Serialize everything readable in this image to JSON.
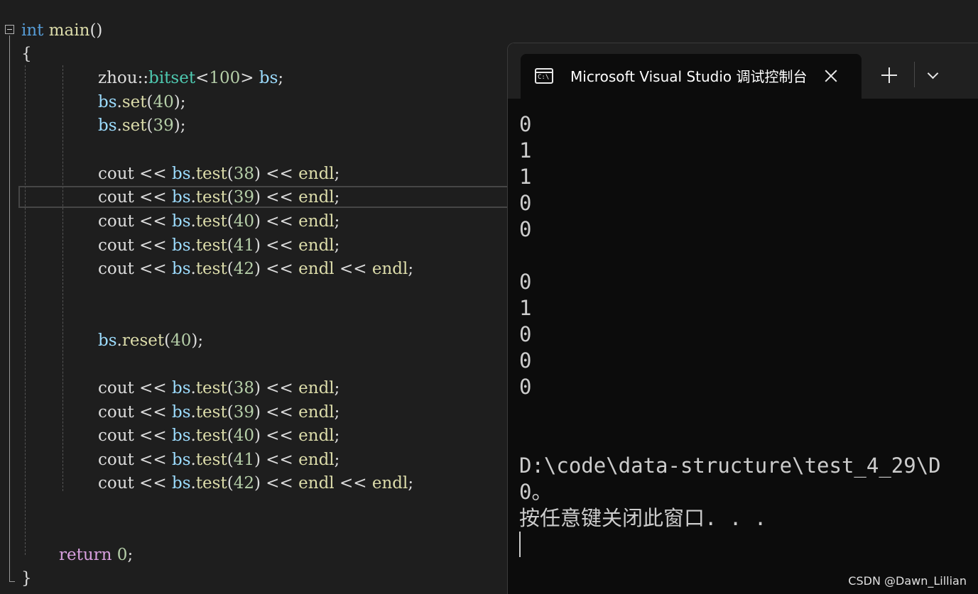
{
  "editor": {
    "lines": [
      [
        {
          "t": "int",
          "c": "kw"
        },
        {
          "t": " ",
          "c": "txt"
        },
        {
          "t": "main",
          "c": "fn"
        },
        {
          "t": "()",
          "c": "txt"
        }
      ],
      [
        {
          "t": "{",
          "c": "txt"
        }
      ],
      [
        {
          "t": "zhou",
          "c": "txt"
        },
        {
          "t": "::",
          "c": "txt"
        },
        {
          "t": "bitset",
          "c": "typ"
        },
        {
          "t": "<",
          "c": "txt"
        },
        {
          "t": "100",
          "c": "num"
        },
        {
          "t": ">",
          "c": "txt"
        },
        {
          "t": " ",
          "c": "txt"
        },
        {
          "t": "bs",
          "c": "var"
        },
        {
          "t": ";",
          "c": "txt"
        }
      ],
      [
        {
          "t": "bs",
          "c": "var"
        },
        {
          "t": ".",
          "c": "txt"
        },
        {
          "t": "set",
          "c": "fn"
        },
        {
          "t": "(",
          "c": "txt"
        },
        {
          "t": "40",
          "c": "num"
        },
        {
          "t": ");",
          "c": "txt"
        }
      ],
      [
        {
          "t": "bs",
          "c": "var"
        },
        {
          "t": ".",
          "c": "txt"
        },
        {
          "t": "set",
          "c": "fn"
        },
        {
          "t": "(",
          "c": "txt"
        },
        {
          "t": "39",
          "c": "num"
        },
        {
          "t": ");",
          "c": "txt"
        }
      ],
      [
        {
          "t": "cout",
          "c": "txt"
        },
        {
          "t": " << ",
          "c": "txt"
        },
        {
          "t": "bs",
          "c": "var"
        },
        {
          "t": ".",
          "c": "txt"
        },
        {
          "t": "test",
          "c": "fn"
        },
        {
          "t": "(",
          "c": "txt"
        },
        {
          "t": "38",
          "c": "num"
        },
        {
          "t": ")",
          "c": "txt"
        },
        {
          "t": " << ",
          "c": "txt"
        },
        {
          "t": "endl",
          "c": "fn"
        },
        {
          "t": ";",
          "c": "txt"
        }
      ],
      [
        {
          "t": "cout",
          "c": "txt"
        },
        {
          "t": " << ",
          "c": "txt"
        },
        {
          "t": "bs",
          "c": "var"
        },
        {
          "t": ".",
          "c": "txt"
        },
        {
          "t": "test",
          "c": "fn"
        },
        {
          "t": "(",
          "c": "txt"
        },
        {
          "t": "39",
          "c": "num"
        },
        {
          "t": ")",
          "c": "txt"
        },
        {
          "t": " << ",
          "c": "txt"
        },
        {
          "t": "endl",
          "c": "fn"
        },
        {
          "t": ";",
          "c": "txt"
        }
      ],
      [
        {
          "t": "cout",
          "c": "txt"
        },
        {
          "t": " << ",
          "c": "txt"
        },
        {
          "t": "bs",
          "c": "var"
        },
        {
          "t": ".",
          "c": "txt"
        },
        {
          "t": "test",
          "c": "fn"
        },
        {
          "t": "(",
          "c": "txt"
        },
        {
          "t": "40",
          "c": "num"
        },
        {
          "t": ")",
          "c": "txt"
        },
        {
          "t": " << ",
          "c": "txt"
        },
        {
          "t": "endl",
          "c": "fn"
        },
        {
          "t": ";",
          "c": "txt"
        }
      ],
      [
        {
          "t": "cout",
          "c": "txt"
        },
        {
          "t": " << ",
          "c": "txt"
        },
        {
          "t": "bs",
          "c": "var"
        },
        {
          "t": ".",
          "c": "txt"
        },
        {
          "t": "test",
          "c": "fn"
        },
        {
          "t": "(",
          "c": "txt"
        },
        {
          "t": "41",
          "c": "num"
        },
        {
          "t": ")",
          "c": "txt"
        },
        {
          "t": " << ",
          "c": "txt"
        },
        {
          "t": "endl",
          "c": "fn"
        },
        {
          "t": ";",
          "c": "txt"
        }
      ],
      [
        {
          "t": "cout",
          "c": "txt"
        },
        {
          "t": " << ",
          "c": "txt"
        },
        {
          "t": "bs",
          "c": "var"
        },
        {
          "t": ".",
          "c": "txt"
        },
        {
          "t": "test",
          "c": "fn"
        },
        {
          "t": "(",
          "c": "txt"
        },
        {
          "t": "42",
          "c": "num"
        },
        {
          "t": ")",
          "c": "txt"
        },
        {
          "t": " << ",
          "c": "txt"
        },
        {
          "t": "endl",
          "c": "fn"
        },
        {
          "t": " << ",
          "c": "txt"
        },
        {
          "t": "endl",
          "c": "fn"
        },
        {
          "t": ";",
          "c": "txt"
        }
      ],
      [
        {
          "t": "bs",
          "c": "var"
        },
        {
          "t": ".",
          "c": "txt"
        },
        {
          "t": "reset",
          "c": "fn"
        },
        {
          "t": "(",
          "c": "txt"
        },
        {
          "t": "40",
          "c": "num"
        },
        {
          "t": ");",
          "c": "txt"
        }
      ],
      [
        {
          "t": "cout",
          "c": "txt"
        },
        {
          "t": " << ",
          "c": "txt"
        },
        {
          "t": "bs",
          "c": "var"
        },
        {
          "t": ".",
          "c": "txt"
        },
        {
          "t": "test",
          "c": "fn"
        },
        {
          "t": "(",
          "c": "txt"
        },
        {
          "t": "38",
          "c": "num"
        },
        {
          "t": ")",
          "c": "txt"
        },
        {
          "t": " << ",
          "c": "txt"
        },
        {
          "t": "endl",
          "c": "fn"
        },
        {
          "t": ";",
          "c": "txt"
        }
      ],
      [
        {
          "t": "cout",
          "c": "txt"
        },
        {
          "t": " << ",
          "c": "txt"
        },
        {
          "t": "bs",
          "c": "var"
        },
        {
          "t": ".",
          "c": "txt"
        },
        {
          "t": "test",
          "c": "fn"
        },
        {
          "t": "(",
          "c": "txt"
        },
        {
          "t": "39",
          "c": "num"
        },
        {
          "t": ")",
          "c": "txt"
        },
        {
          "t": " << ",
          "c": "txt"
        },
        {
          "t": "endl",
          "c": "fn"
        },
        {
          "t": ";",
          "c": "txt"
        }
      ],
      [
        {
          "t": "cout",
          "c": "txt"
        },
        {
          "t": " << ",
          "c": "txt"
        },
        {
          "t": "bs",
          "c": "var"
        },
        {
          "t": ".",
          "c": "txt"
        },
        {
          "t": "test",
          "c": "fn"
        },
        {
          "t": "(",
          "c": "txt"
        },
        {
          "t": "40",
          "c": "num"
        },
        {
          "t": ")",
          "c": "txt"
        },
        {
          "t": " << ",
          "c": "txt"
        },
        {
          "t": "endl",
          "c": "fn"
        },
        {
          "t": ";",
          "c": "txt"
        }
      ],
      [
        {
          "t": "cout",
          "c": "txt"
        },
        {
          "t": " << ",
          "c": "txt"
        },
        {
          "t": "bs",
          "c": "var"
        },
        {
          "t": ".",
          "c": "txt"
        },
        {
          "t": "test",
          "c": "fn"
        },
        {
          "t": "(",
          "c": "txt"
        },
        {
          "t": "41",
          "c": "num"
        },
        {
          "t": ")",
          "c": "txt"
        },
        {
          "t": " << ",
          "c": "txt"
        },
        {
          "t": "endl",
          "c": "fn"
        },
        {
          "t": ";",
          "c": "txt"
        }
      ],
      [
        {
          "t": "cout",
          "c": "txt"
        },
        {
          "t": " << ",
          "c": "txt"
        },
        {
          "t": "bs",
          "c": "var"
        },
        {
          "t": ".",
          "c": "txt"
        },
        {
          "t": "test",
          "c": "fn"
        },
        {
          "t": "(",
          "c": "txt"
        },
        {
          "t": "42",
          "c": "num"
        },
        {
          "t": ")",
          "c": "txt"
        },
        {
          "t": " << ",
          "c": "txt"
        },
        {
          "t": "endl",
          "c": "fn"
        },
        {
          "t": " << ",
          "c": "txt"
        },
        {
          "t": "endl",
          "c": "fn"
        },
        {
          "t": ";",
          "c": "txt"
        }
      ],
      [
        {
          "t": "return",
          "c": "ctl"
        },
        {
          "t": " ",
          "c": "txt"
        },
        {
          "t": "0",
          "c": "num"
        },
        {
          "t": ";",
          "c": "txt"
        }
      ],
      [
        {
          "t": "}",
          "c": "txt"
        }
      ]
    ]
  },
  "terminal": {
    "tab_title": "Microsoft Visual Studio 调试控制台",
    "icon_label": "C:\\",
    "output_block_1": [
      "0",
      "1",
      "1",
      "0",
      "0"
    ],
    "output_block_2": [
      "0",
      "1",
      "0",
      "0",
      "0"
    ],
    "exit_path": "D:\\code\\data-structure\\test_4_29\\D",
    "exit_code_line": "0。",
    "press_key_line": "按任意键关闭此窗口. . ."
  },
  "watermark": "CSDN @Dawn_Lillian",
  "icons": {
    "fold": "collapse-icon",
    "cmd": "console-icon",
    "close": "close-icon",
    "new_tab": "plus-icon",
    "dropdown": "chevron-down-icon"
  }
}
